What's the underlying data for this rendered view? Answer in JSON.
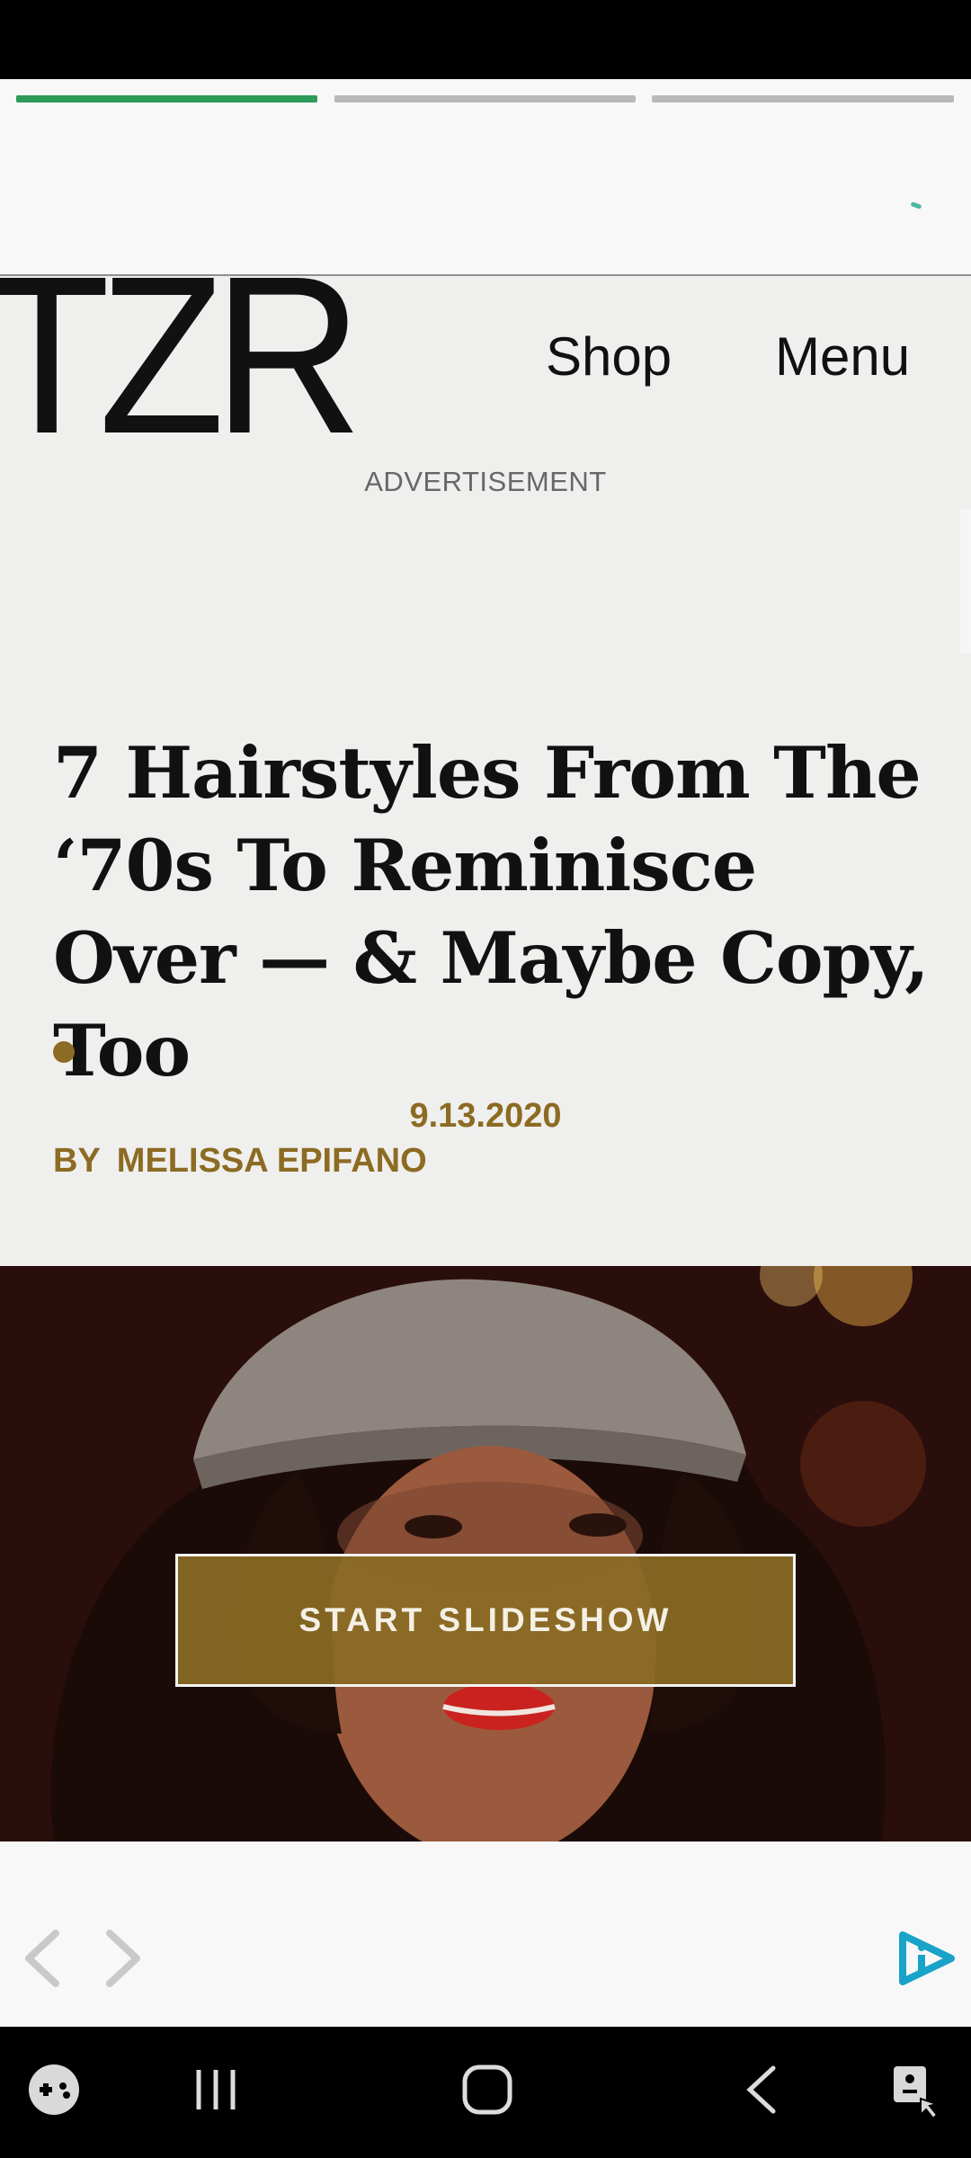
{
  "story": {
    "progress": [
      1.0,
      0.0,
      0.0
    ],
    "accent_color": "#2e9b59",
    "track_color": "#b9b9b9"
  },
  "header": {
    "logo": "TZR",
    "shop_label": "Shop",
    "menu_label": "Menu"
  },
  "ad": {
    "label": "ADVERTISEMENT"
  },
  "article": {
    "headline": "7 Hairstyles From The ‘70s To Reminisce Over — & Maybe Copy, Too",
    "date": "9.13.2020",
    "byline_prefix": "BY",
    "author": "MELISSA EPIFANO",
    "accent_color": "#8c6b22"
  },
  "hero": {
    "button_label": "START SLIDESHOW"
  },
  "bottom_nav": {
    "prev_icon": "chevron-left-icon",
    "next_icon": "chevron-right-icon",
    "badge_icon": "play-info-icon",
    "badge_color": "#1aa3c9"
  },
  "system_nav": {
    "icons": [
      "game-launcher-icon",
      "recent-apps-icon",
      "home-icon",
      "back-icon",
      "accessibility-icon"
    ]
  }
}
